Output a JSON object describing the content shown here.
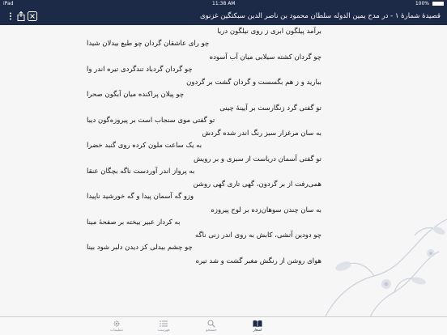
{
  "status_bar": {
    "carrier": "iPad",
    "time": "11:38 AM",
    "battery": "100%"
  },
  "nav": {
    "title": "قصیدهٔ شمارهٔ ۱ - در مدح یمین الدوله سلطان محمود بن ناصر الدین سبکتگین غزنوی"
  },
  "poem": {
    "verses": [
      {
        "h1": "برآمد پیلگون ابری ز روی نیلگون دریا",
        "h2": "چو رای عاشقان گردان چو طبع بیدلان شیدا"
      },
      {
        "h1": "چو گردان کشته سیلابی میان آب آسوده",
        "h2": "چو گردان گردباد تندگردی تیره اندر وا"
      },
      {
        "h1": "ببارید و ز هم بگسست و گردان گشت بر گردون",
        "h2": "چو پیلان پراکنده میان آبگون صحرا"
      },
      {
        "h1": "تو گفتی گرد زنگارست بر آیینهٔ چینی",
        "h2": "تو گفتی موی سنجاب است بر پیروزه‌گون دیبا"
      },
      {
        "h1": "به سان مرغزار سبز رنگ اندر شده گردش",
        "h2": "به یک ساعت ملون کرده روی گنبد خضرا"
      },
      {
        "h1": "تو گفتی آسمان دریاست از سبزی و بر رویش",
        "h2": "به پرواز اندر آوردست ناگه بچگان عنقا"
      },
      {
        "h1": "همی‌رفت از بر گردون، گهی تاری گهی روشن",
        "h2": "وزو گه آسمان پیدا و گه خورشید ناپیدا"
      },
      {
        "h1": "به سان چندن سوهان‌زده بر لوح پیروزه",
        "h2": "به کردار عبیر بیخته بر صفحهٔ مینا"
      },
      {
        "h1": "چو دودین آتشی، کابش به روی اندر زنی ناگه",
        "h2": "چو چشم بیدلی کز دیدن دلبر شود بینا"
      },
      {
        "h1": "هوای روشن از رنگش مغبر گشت و شد تیره",
        "h2": ""
      }
    ]
  },
  "tabs": [
    {
      "label": "اشعار",
      "icon": "book-icon",
      "active": true
    },
    {
      "label": "جستجو",
      "icon": "search-icon",
      "active": false
    },
    {
      "label": "فهرست",
      "icon": "list-icon",
      "active": false
    },
    {
      "label": "تنظیمات",
      "icon": "gear-icon",
      "active": false
    }
  ],
  "colors": {
    "nav_bg": "#1c2a47",
    "content_bg": "#f6f6f6",
    "active_tab": "#1c2a47"
  }
}
